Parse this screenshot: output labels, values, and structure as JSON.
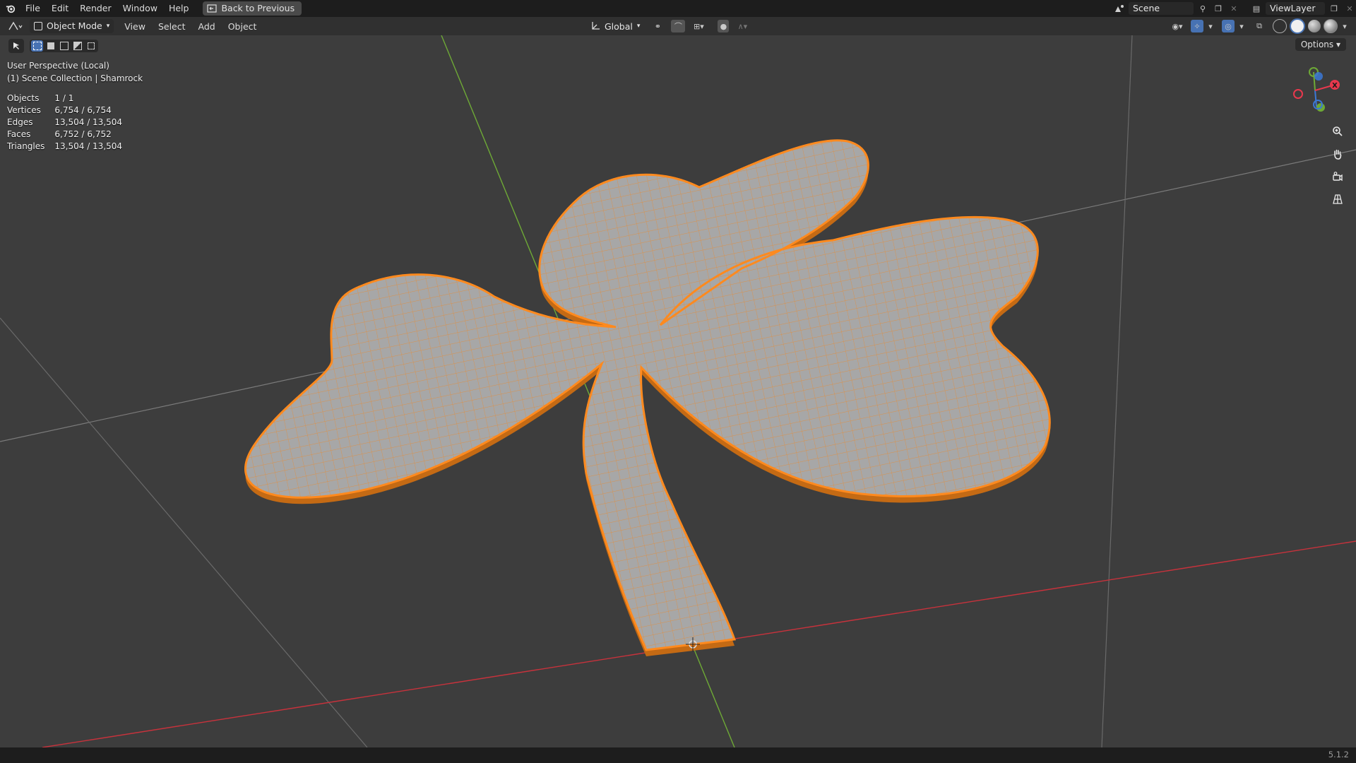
{
  "topbar": {
    "menus": [
      "File",
      "Edit",
      "Render",
      "Window",
      "Help"
    ],
    "back_button": "Back to Previous",
    "scene_name": "Scene",
    "view_layer": "ViewLayer"
  },
  "header": {
    "mode": "Object Mode",
    "menus": [
      "View",
      "Select",
      "Add",
      "Object"
    ],
    "transform_orientation": "Global",
    "options_label": "Options"
  },
  "viewport": {
    "perspective_label": "User Perspective (Local)",
    "collection_label": "(1) Scene Collection | Shamrock",
    "stats": [
      {
        "label": "Objects",
        "value": "1 / 1"
      },
      {
        "label": "Vertices",
        "value": "6,754 / 6,754"
      },
      {
        "label": "Edges",
        "value": "13,504 / 13,504"
      },
      {
        "label": "Faces",
        "value": "6,752 / 6,752"
      },
      {
        "label": "Triangles",
        "value": "13,504 / 13,504"
      }
    ],
    "gizmo": {
      "x_label": "X",
      "x_color": "#e8384d",
      "y_color": "#6ea936",
      "z_color": "#3b78d6"
    },
    "object_colors": {
      "fill": "#a7a7a7",
      "outline": "#ff8a1e",
      "wire": "#e98a2e"
    }
  },
  "statusbar": {
    "version": "5.1.2"
  }
}
